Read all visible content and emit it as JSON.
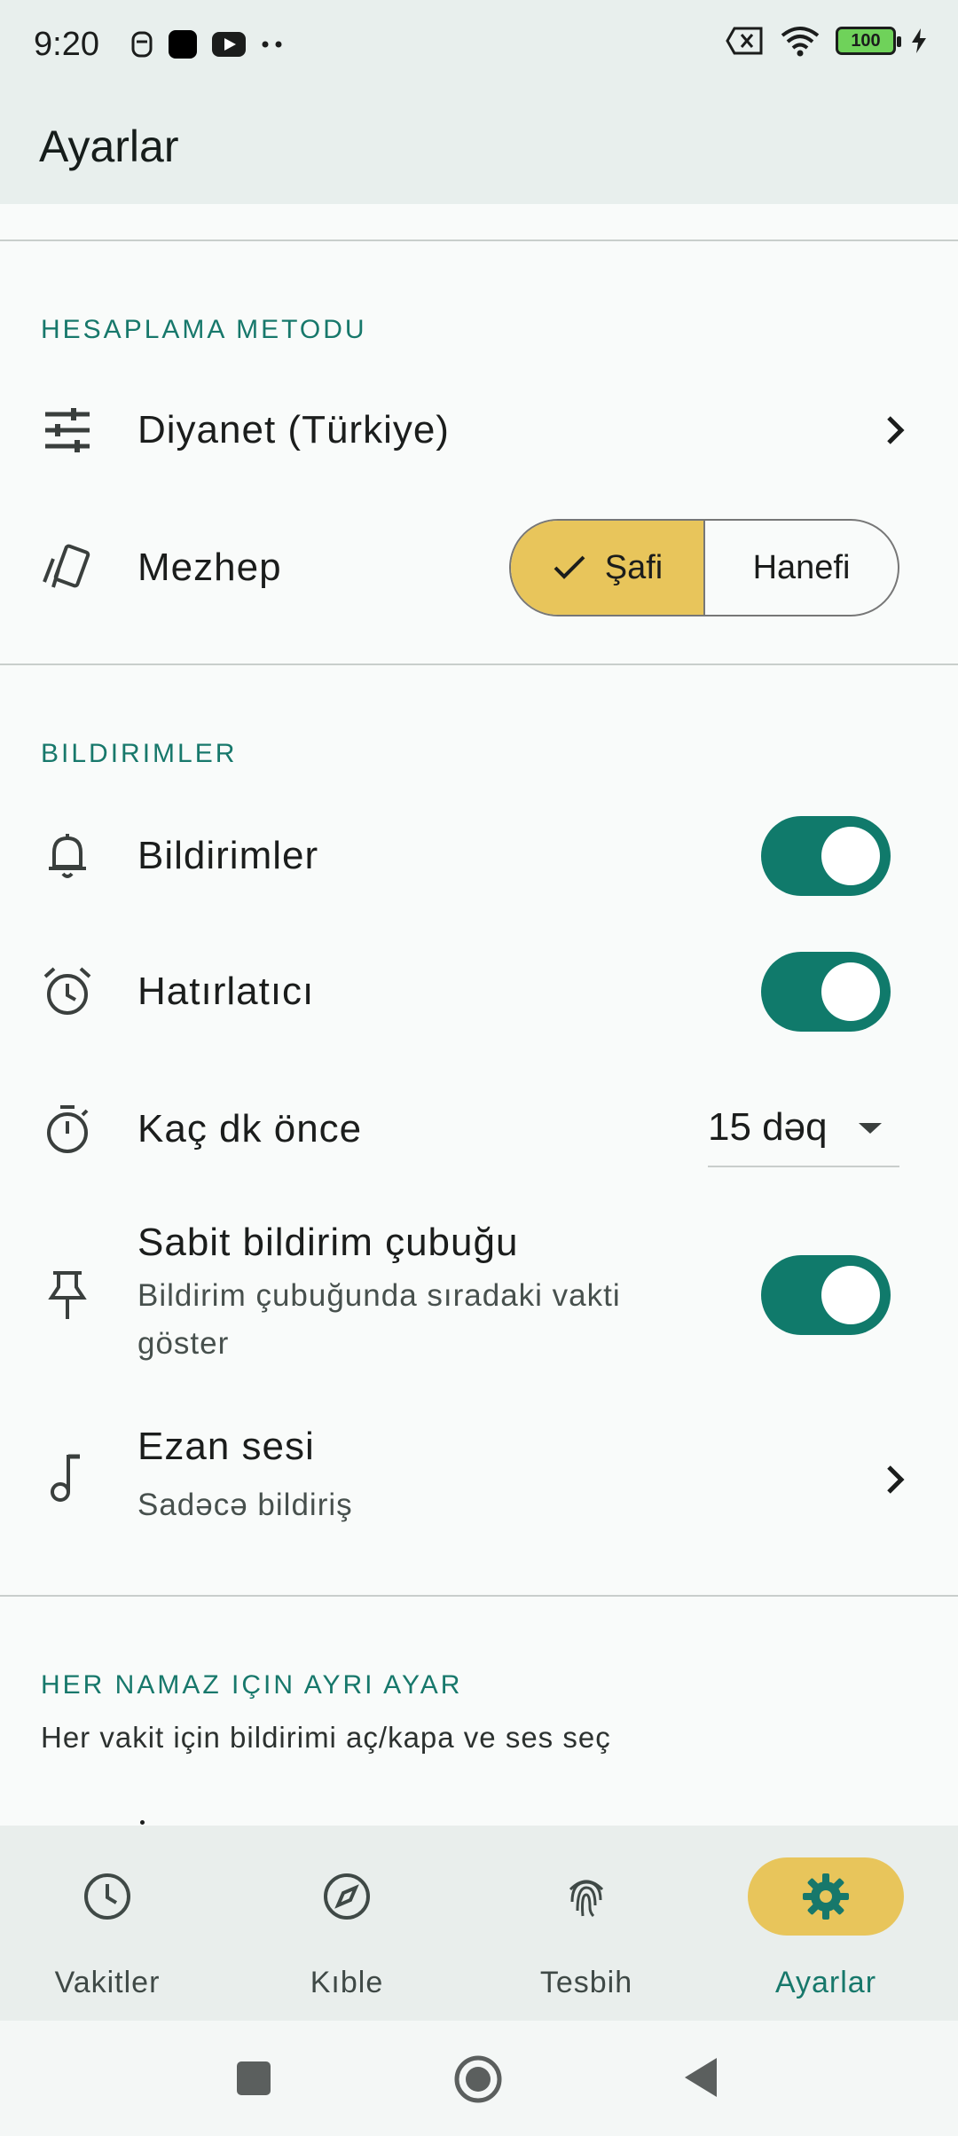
{
  "status_bar": {
    "time": "9:20",
    "battery": "100"
  },
  "app_bar": {
    "title": "Ayarlar"
  },
  "sections": {
    "calculation": {
      "header": "HESAPLAMA METODU",
      "method_label": "Diyanet (Türkiye)",
      "madhab_label": "Mezhep",
      "madhab_options": [
        "Şafi",
        "Hanefi"
      ],
      "madhab_selected": "Şafi"
    },
    "notifications": {
      "header": "BILDIRIMLER",
      "notifications_label": "Bildirimler",
      "notifications_on": true,
      "reminder_label": "Hatırlatıcı",
      "reminder_on": true,
      "minutes_before_label": "Kaç dk önce",
      "minutes_before_value": "15 dəq",
      "sticky_label": "Sabit bildirim çubuğu",
      "sticky_sub": "Bildirim çubuğunda sıradaki vakti göster",
      "sticky_on": true,
      "adhan_label": "Ezan sesi",
      "adhan_sub": "Sadəcə bildiriş"
    },
    "per_prayer": {
      "header": "HER NAMAZ IÇIN AYRI AYAR",
      "description": "Her vakit için bildirimi aç/kapa ve ses seç"
    }
  },
  "bottom_nav": {
    "items": [
      {
        "label": "Vakitler",
        "icon": "clock-icon"
      },
      {
        "label": "Kıble",
        "icon": "compass-icon"
      },
      {
        "label": "Tesbih",
        "icon": "fingerprint-icon"
      },
      {
        "label": "Ayarlar",
        "icon": "gear-icon"
      }
    ],
    "active": "Ayarlar"
  },
  "colors": {
    "accent": "#107a6b",
    "selected": "#e8c55b",
    "surface": "#e8efed"
  }
}
